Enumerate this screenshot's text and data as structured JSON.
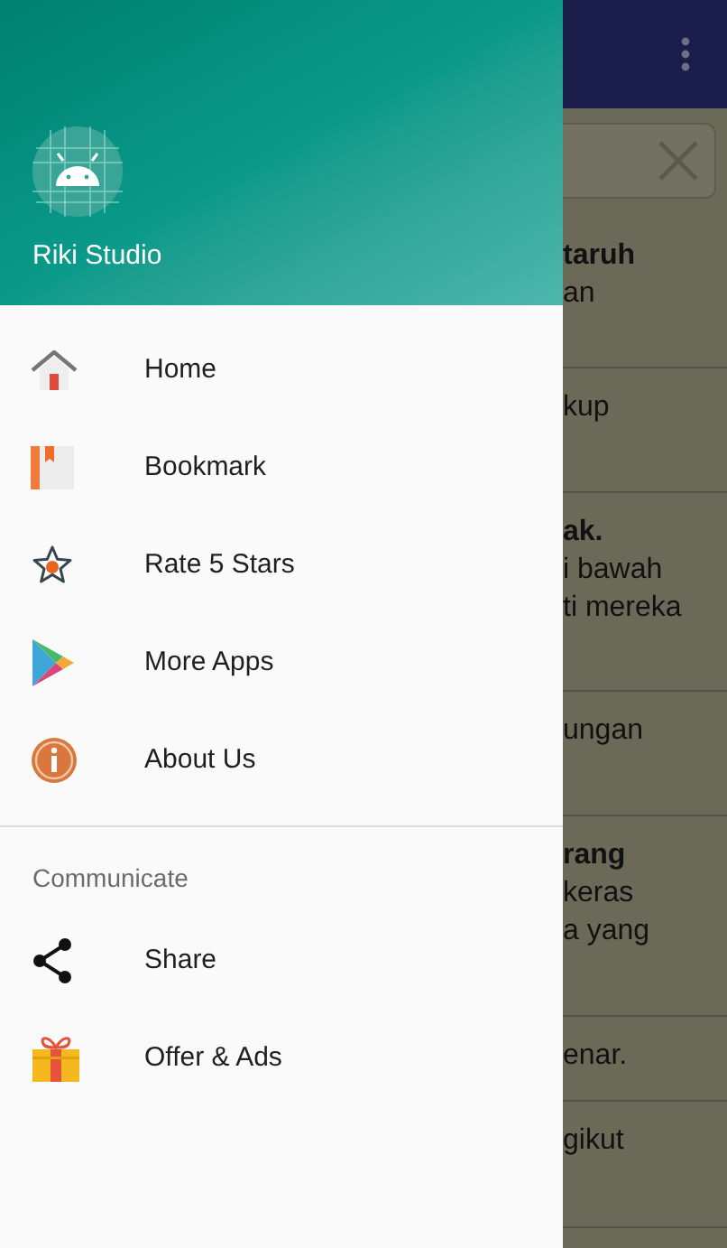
{
  "drawer": {
    "header": {
      "title": "Riki Studio"
    },
    "items": [
      {
        "label": "Home"
      },
      {
        "label": "Bookmark"
      },
      {
        "label": "Rate 5 Stars"
      },
      {
        "label": "More Apps"
      },
      {
        "label": "About Us"
      }
    ],
    "section": {
      "title": "Communicate",
      "items": [
        {
          "label": "Share"
        },
        {
          "label": "Offer & Ads"
        }
      ]
    }
  },
  "background": {
    "rows": [
      {
        "title": "taruh",
        "lines": [
          "an"
        ]
      },
      {
        "lines": [
          "kup"
        ]
      },
      {
        "title": "ak.",
        "lines": [
          "i bawah",
          "ti mereka"
        ]
      },
      {
        "lines": [
          "ungan"
        ]
      },
      {
        "title": "rang",
        "lines": [
          "keras",
          "a yang"
        ]
      },
      {
        "lines": [
          "enar."
        ]
      },
      {
        "lines": [
          "gikut"
        ]
      }
    ]
  }
}
